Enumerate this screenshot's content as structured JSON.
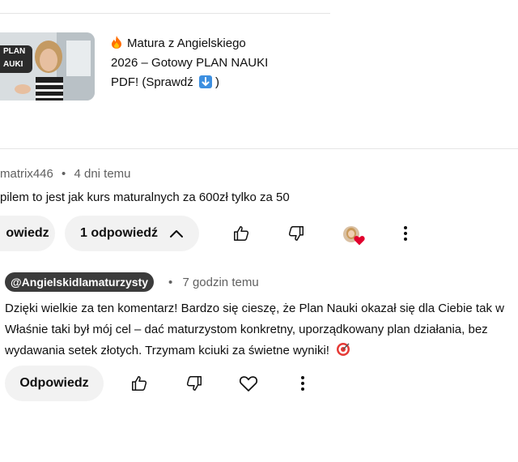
{
  "video": {
    "title_lines": [
      "Matura z Angielskiego",
      "2026 – Gotowy PLAN NAUKI",
      "PDF! (Sprawdź"
    ],
    "title_end": ")",
    "thumb_badge_lines": [
      "PLAN",
      "AUKI"
    ],
    "fire_icon": "fire-icon",
    "down_arrow_icon": "down-arrow-emoji-icon"
  },
  "comment": {
    "author": "matrix446",
    "separator": "•",
    "time": "4 dni temu",
    "text": "pilem to jest jak kurs maturalnych za 600zł tylko za 50",
    "reply_label": "owiedz",
    "replies_label": "1 odpowiedź"
  },
  "reply": {
    "author": "@Angielskidlamaturzysty",
    "separator": "•",
    "time": "7 godzin temu",
    "lines": [
      "Dzięki wielkie za ten komentarz! Bardzo się cieszę, że Plan Nauki okazał się dla Ciebie tak w",
      "Właśnie taki był mój cel – dać maturzystom konkretny, uporządkowany plan działania, bez",
      "wydawania setek złotych. Trzymam kciuki za świetne wyniki!"
    ],
    "reply_label": "Odpowiedz"
  },
  "colors": {
    "heart": "#e1002d",
    "badge_bg": "#3b3b3b",
    "pill_bg": "#f2f2f2",
    "meta": "#606060"
  }
}
